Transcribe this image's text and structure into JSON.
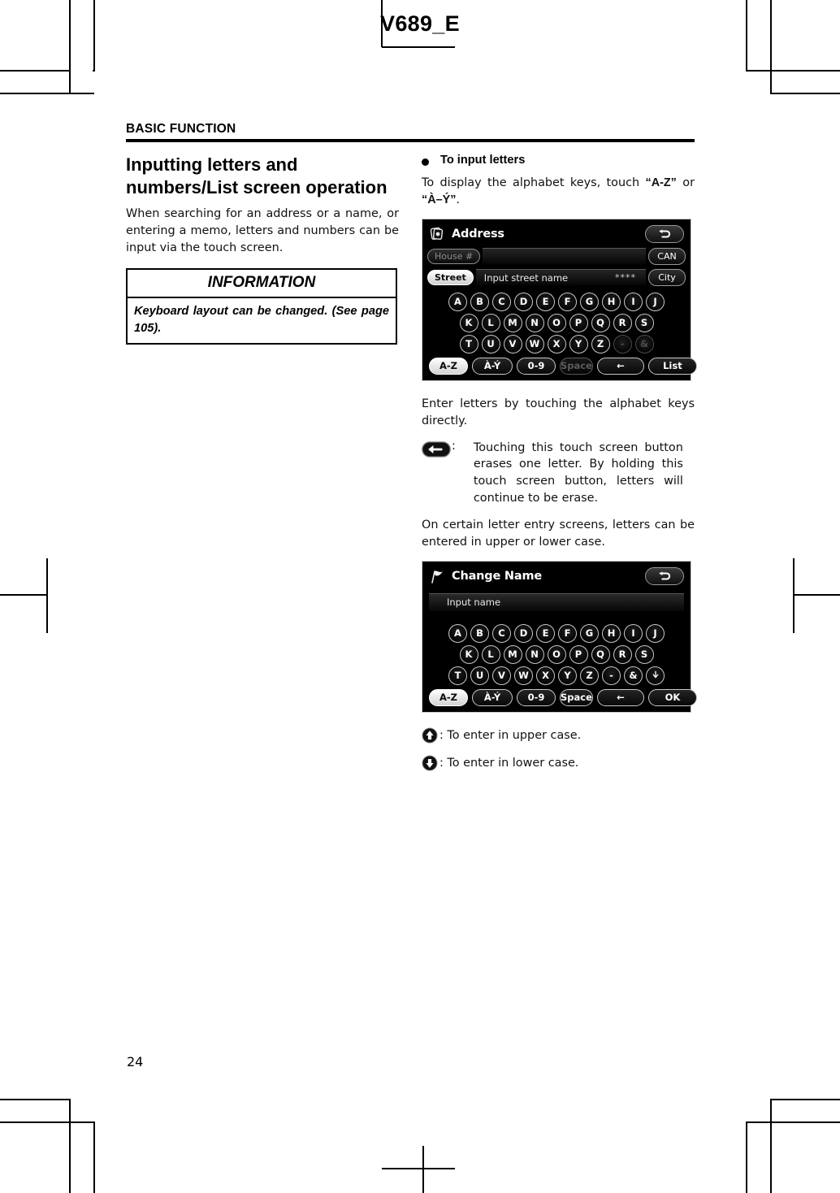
{
  "document": {
    "code": "V689_E",
    "running_head": "BASIC FUNCTION",
    "page_number": "24"
  },
  "left_column": {
    "headline": "Inputting letters and numbers/List screen operation",
    "intro": "When searching for an address or a name, or entering a memo, letters and numbers can be input via the touch screen.",
    "information": {
      "heading": "INFORMATION",
      "body": "Keyboard layout can be changed. (See page 105)."
    }
  },
  "right_column": {
    "bullet_heading": "To input letters",
    "instruction_prefix": "To display the alphabet keys, touch ",
    "instruction_key1": "“A-Z”",
    "instruction_or": " or ",
    "instruction_key2": "“À–Ý”",
    "instruction_suffix": ".",
    "after_shot_1": "Enter letters by touching the alphabet keys directly.",
    "erase_note": "Touching this touch screen button erases one letter.  By holding this touch screen button, letters will continue to be erase.",
    "case_note": "On certain letter entry screens, letters can be entered in upper or lower case.",
    "legend": [
      {
        "icon": "arrow-up-icon",
        "text": ": To enter in upper case."
      },
      {
        "icon": "arrow-down-icon",
        "text": ": To enter in lower case."
      }
    ]
  },
  "screenshot_address": {
    "title": "Address",
    "title_icon": "card-stack-icon",
    "back_button": "back-arrow-icon",
    "rows": [
      {
        "pill": "House #",
        "pill_state": "dark",
        "placeholder": "",
        "side": "CAN"
      },
      {
        "pill": "Street",
        "pill_state": "light",
        "placeholder": "Input street name",
        "stars": "****",
        "side": "City"
      }
    ],
    "keyboard": {
      "row1": [
        "A",
        "B",
        "C",
        "D",
        "E",
        "F",
        "G",
        "H",
        "I",
        "J"
      ],
      "row2": [
        "K",
        "L",
        "M",
        "N",
        "O",
        "P",
        "Q",
        "R",
        "S"
      ],
      "row3": [
        "T",
        "U",
        "V",
        "W",
        "X",
        "Y",
        "Z",
        "-",
        "&"
      ],
      "row3_disabled": [
        "-",
        "&"
      ],
      "bottom": [
        {
          "label": "A-Z",
          "state": "light"
        },
        {
          "label": "À-Ý",
          "state": "dark"
        },
        {
          "label": "0-9",
          "state": "dark"
        },
        {
          "label": "Space",
          "state": "dim"
        },
        {
          "label": "←",
          "state": "dark"
        },
        {
          "label": "List",
          "state": "dark"
        }
      ]
    }
  },
  "screenshot_change_name": {
    "title": "Change Name",
    "title_icon": "flag-icon",
    "back_button": "back-arrow-icon",
    "input_placeholder": "Input name",
    "keyboard": {
      "row1": [
        "A",
        "B",
        "C",
        "D",
        "E",
        "F",
        "G",
        "H",
        "I",
        "J"
      ],
      "row2": [
        "K",
        "L",
        "M",
        "N",
        "O",
        "P",
        "Q",
        "R",
        "S"
      ],
      "row3": [
        "T",
        "U",
        "V",
        "W",
        "X",
        "Y",
        "Z",
        "-",
        "&"
      ],
      "row3_extra_icon": "arrow-down-key-icon",
      "bottom": [
        {
          "label": "A-Z",
          "state": "light"
        },
        {
          "label": "À-Ý",
          "state": "dark"
        },
        {
          "label": "0-9",
          "state": "dark"
        },
        {
          "label": "Space",
          "state": "dark"
        },
        {
          "label": "←",
          "state": "dark"
        },
        {
          "label": "OK",
          "state": "dark"
        }
      ]
    }
  }
}
